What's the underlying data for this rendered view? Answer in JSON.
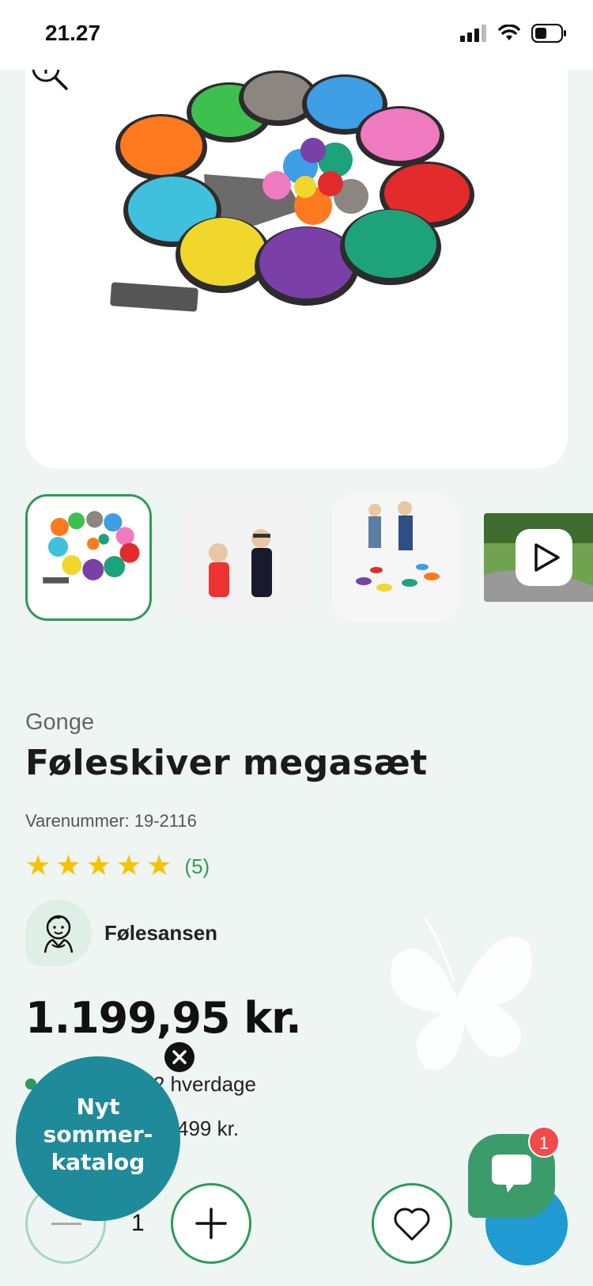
{
  "status_bar": {
    "time": "21.27"
  },
  "product": {
    "brand": "Gonge",
    "title": "Føleskiver megasæt",
    "sku": "Varenummer: 19-2116",
    "rating_value": 5,
    "rating_count": "(5)",
    "sense_label": "Følesansen",
    "price": "1.199,95 kr.",
    "delivery": "Levering 1–2 hverdage",
    "free_shipping_partial": "499 kr."
  },
  "cart": {
    "quantity": "1"
  },
  "promo": {
    "text": "Nyt\nsommer-\nkatalog"
  },
  "chat": {
    "badge_count": "1"
  },
  "colors": {
    "accent_green": "#2f9a5a",
    "promo_teal": "#1f8a99",
    "cart_blue": "#1f9ad2",
    "chat_green": "#3c9b6b",
    "badge_red": "#f24a4a",
    "star_yellow": "#f5c400"
  },
  "icons": [
    "signal-icon",
    "wifi-icon",
    "battery-icon",
    "zoom-icon",
    "play-icon",
    "star-icon",
    "sense-icon",
    "minus-icon",
    "plus-icon",
    "heart-icon",
    "chat-icon",
    "close-icon",
    "butterfly-icon"
  ]
}
